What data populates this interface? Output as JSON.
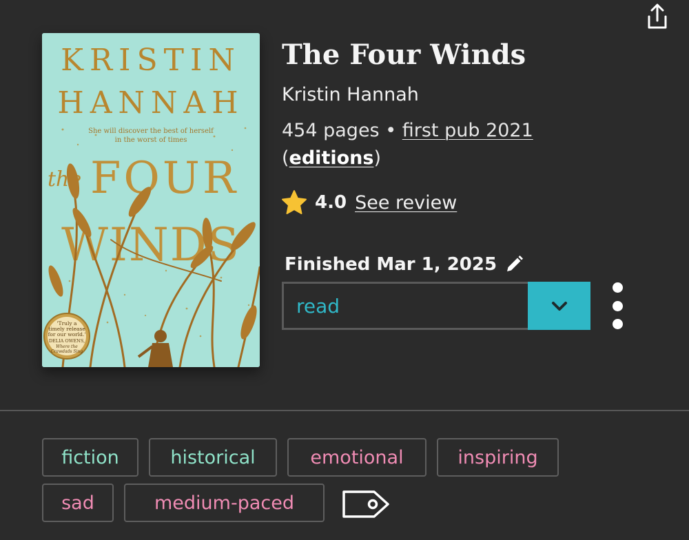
{
  "book": {
    "title": "The Four Winds",
    "author": "Kristin Hannah",
    "pages": "454 pages",
    "separator": "•",
    "first_pub": "first pub 2021",
    "editions_open": "(",
    "editions_label": "editions",
    "editions_close": ")",
    "rating": "4.0",
    "see_review": "See review",
    "finished": "Finished Mar 1, 2025"
  },
  "cover": {
    "author_line1": "KRISTIN",
    "author_line2": "HANNAH",
    "tagline_line1": "She will discover the best of herself",
    "tagline_line2": "in the worst of times",
    "title_the": "the",
    "title_four": "FOUR",
    "title_winds": "WINDS",
    "seal_line1": "'Truly a",
    "seal_line2": "timely release",
    "seal_line3": "for our world.'",
    "seal_line4": "DELIA OWENS,",
    "seal_line5": "Where the",
    "seal_line6": "Crawdads Sing",
    "background_color": "#a9e2d8",
    "gold_color": "#b8862e"
  },
  "status": {
    "value": "read",
    "accent_color": "#2fb7c6"
  },
  "tags": {
    "genre_color": "#8fe2c8",
    "mood_color": "#f08cb4",
    "items": [
      "fiction",
      "historical",
      "emotional",
      "inspiring",
      "sad",
      "medium-paced"
    ]
  },
  "icons": {
    "share": "share-icon",
    "star": "star-icon",
    "edit": "pencil-icon",
    "dropdown": "chevron-down-icon",
    "more": "more-vertical-icon",
    "add_tag": "tag-icon"
  }
}
